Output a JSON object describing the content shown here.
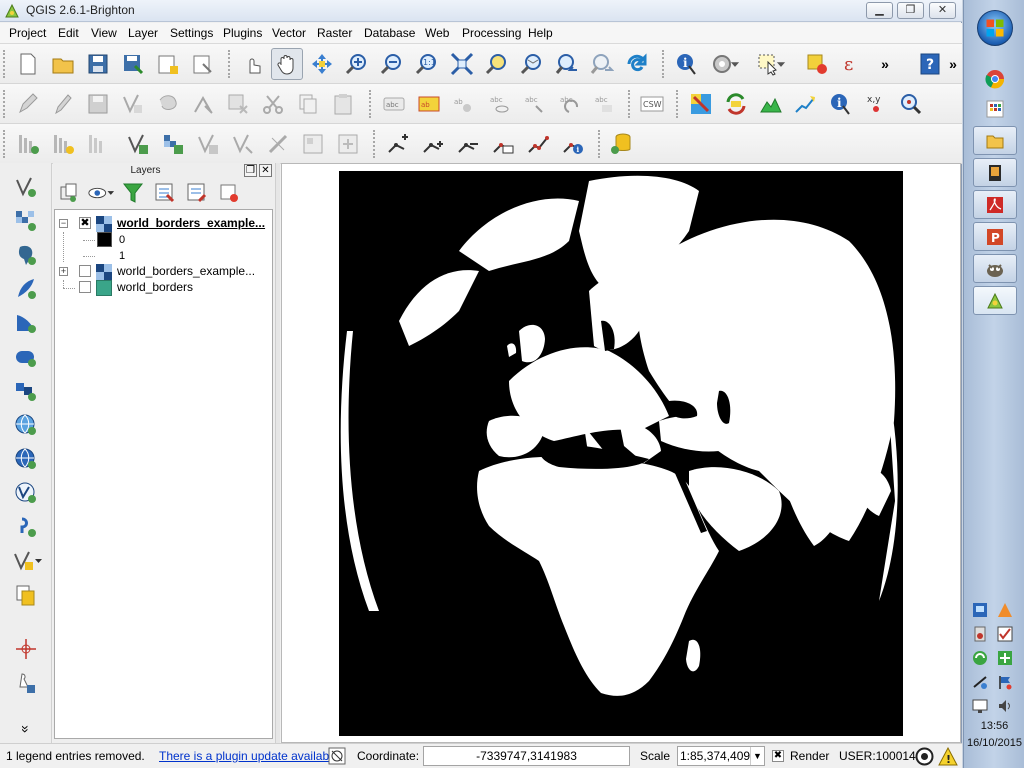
{
  "window": {
    "title": "QGIS 2.6.1-Brighton",
    "min_glyph": "▁",
    "max_glyph": "❐",
    "close_glyph": "✕"
  },
  "menu": [
    "Project",
    "Edit",
    "View",
    "Layer",
    "Settings",
    "Plugins",
    "Vector",
    "Raster",
    "Database",
    "Web",
    "Processing",
    "Help"
  ],
  "toolbar_more": "»",
  "layers_panel": {
    "title": "Layers",
    "float_glyph": "❐",
    "close_glyph": "✕",
    "tree": [
      {
        "name": "world_borders_example...",
        "checked": true,
        "expanded": true,
        "bold": true,
        "legend": [
          {
            "label": "0",
            "color": "#000000"
          },
          {
            "label": "1",
            "color": "#ffffff"
          }
        ]
      },
      {
        "name": "world_borders_example...",
        "checked": false,
        "expanded": false,
        "bold": false
      },
      {
        "name": "world_borders",
        "checked": false,
        "color": "#3aa589"
      }
    ],
    "check_glyph": "✖",
    "expanded_glyph": "−",
    "collapsed_glyph": "+"
  },
  "statusbar": {
    "message": "1 legend entries removed.",
    "plugin_link": "There is a plugin update available",
    "coordinate_label": "Coordinate:",
    "coordinate_value": "-7339747,3141983",
    "scale_label": "Scale",
    "scale_value": "1:85,374,409",
    "scale_arrow": "▼",
    "render_label": "Render",
    "render_glyph": "✖",
    "crs": "USER:100014"
  },
  "dock_more": "»",
  "taskbar": {
    "time": "13:56",
    "date": "16/10/2015"
  },
  "colors": {
    "map_background": "#000000",
    "land": "#ffffff",
    "link": "#0033cc"
  }
}
